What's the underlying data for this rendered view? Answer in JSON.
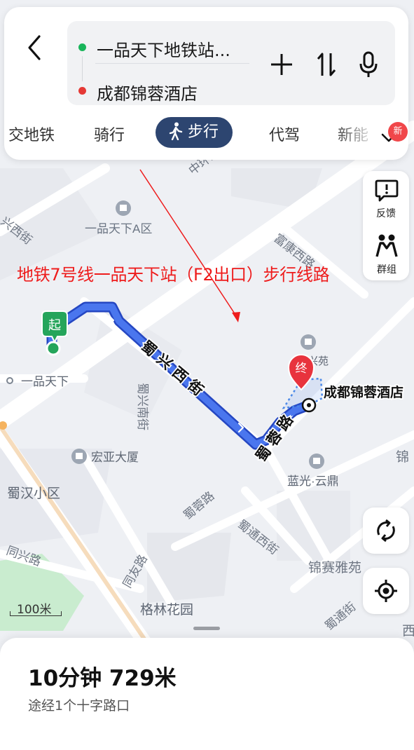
{
  "route_input": {
    "origin": "一品天下地铁站...",
    "destination": "成都锦蓉酒店"
  },
  "icons": {
    "back": "back-chevron-icon",
    "add": "plus-icon",
    "swap": "swap-arrows-icon",
    "voice": "microphone-icon",
    "walk": "walking-person-icon"
  },
  "modes": {
    "items": [
      "交地铁",
      "骑行",
      "步行",
      "代驾",
      "新能"
    ],
    "active": "步行",
    "new_badge": "新"
  },
  "side_panel": {
    "feedback_label": "反馈",
    "group_label": "群组"
  },
  "map": {
    "annotation": "地铁7号线一品天下站（F2出口）步行线路",
    "start_marker": "起",
    "end_marker": "终",
    "labels": {
      "zhonghuan": "中环路",
      "yipin_a": "一品天下A区",
      "xingxi_top": "兴西街",
      "fukang": "富康西路",
      "yipin": "一品天下",
      "shuxingxi": "蜀兴西街",
      "shuxingnan": "蜀兴南街",
      "shurong": "蜀蓉路",
      "hongya": "宏亚大厦",
      "shuxingyuan": "蜀兴苑",
      "hotel": "成都锦蓉酒店",
      "lanyun": "蓝光·云鼎",
      "shuhan": "蜀汉小区",
      "shurong_lower": "蜀蓉路",
      "shutong": "蜀通西街",
      "tongxing": "同兴路",
      "tongyou": "同友路",
      "jinsai": "锦赛雅苑",
      "gelin": "格林花园",
      "jin_right": "锦",
      "shutong_lower": "蜀通街",
      "xi_right": "西"
    },
    "colors": {
      "route": "#3d68e8",
      "route_edge": "#2547c2",
      "start_green": "#25a55b",
      "end_red": "#e8333d",
      "annotation_red": "#ee1c1c"
    }
  },
  "scale": {
    "label": "100米"
  },
  "summary": {
    "time_distance": "10分钟  729米",
    "detail": "途经1个十字路口"
  }
}
